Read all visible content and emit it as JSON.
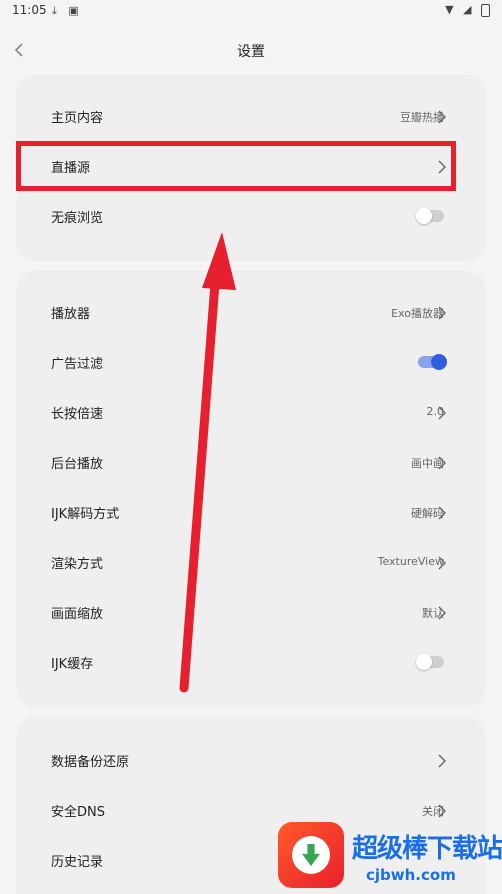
{
  "status_bar": {
    "time": "11:05",
    "left_icons": [
      "download-icon",
      "notification-icon"
    ],
    "right_icons": [
      "wifi-icon",
      "signal-icon",
      "battery-icon"
    ]
  },
  "header": {
    "title": "设置",
    "back_icon": "chevron-left-icon"
  },
  "sections": [
    {
      "items": [
        {
          "label": "主页内容",
          "value": "豆瓣热播",
          "control": "chevron"
        },
        {
          "label": "直播源",
          "value": "",
          "control": "chevron"
        },
        {
          "label": "无痕浏览",
          "control": "toggle",
          "toggle_on": false
        }
      ]
    },
    {
      "items": [
        {
          "label": "播放器",
          "value": "Exo播放器",
          "control": "chevron"
        },
        {
          "label": "广告过滤",
          "control": "toggle",
          "toggle_on": true
        },
        {
          "label": "长按倍速",
          "value": "2.0",
          "control": "chevron"
        },
        {
          "label": "后台播放",
          "value": "画中画",
          "control": "chevron"
        },
        {
          "label": "IJK解码方式",
          "value": "硬解码",
          "control": "chevron"
        },
        {
          "label": "渲染方式",
          "value": "TextureView",
          "control": "chevron"
        },
        {
          "label": "画面缩放",
          "value": "默认",
          "control": "chevron"
        },
        {
          "label": "IJK缓存",
          "control": "toggle",
          "toggle_on": false
        }
      ]
    },
    {
      "items": [
        {
          "label": "数据备份还原",
          "value": "",
          "control": "chevron"
        },
        {
          "label": "安全DNS",
          "value": "关闭",
          "control": "chevron"
        },
        {
          "label": "历史记录",
          "value": "",
          "control": "chevron"
        }
      ]
    }
  ],
  "annotation": {
    "highlight_color": "#e6202e"
  },
  "watermark": {
    "text": "超级棒下载站",
    "url": "cjbwh.com"
  },
  "colors": {
    "accent": "#2f5fe0",
    "background": "#f4f4f4",
    "card": "#efefef"
  }
}
